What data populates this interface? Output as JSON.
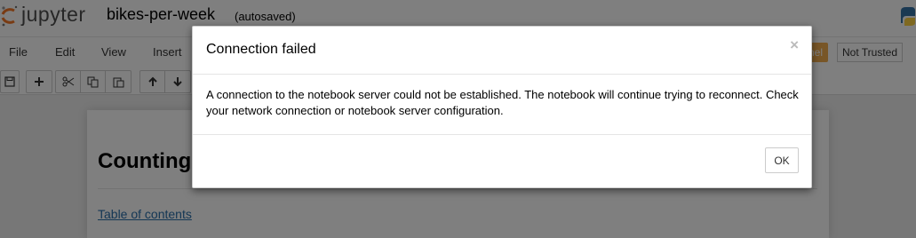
{
  "header": {
    "logo_text": "jupyter",
    "notebook_name": "bikes-per-week",
    "autosave_status": "(autosaved)",
    "logo_accent_color": "#f37726"
  },
  "menubar": {
    "items": [
      "File",
      "Edit",
      "View",
      "Insert"
    ],
    "kernel_badge": "rnel",
    "trust_badge": "Not Trusted"
  },
  "toolbar": {
    "icons": [
      "save-icon",
      "plus-icon",
      "cut-icon",
      "copy-icon",
      "paste-icon",
      "arrow-up-icon",
      "arrow-down-icon"
    ]
  },
  "notebook": {
    "heading": "Counting",
    "toc_link": "Table of contents"
  },
  "modal": {
    "title": "Connection failed",
    "close_glyph": "×",
    "body": "A connection to the notebook server could not be established. The notebook will continue trying to reconnect. Check your network connection or notebook server configuration.",
    "ok_label": "OK"
  }
}
